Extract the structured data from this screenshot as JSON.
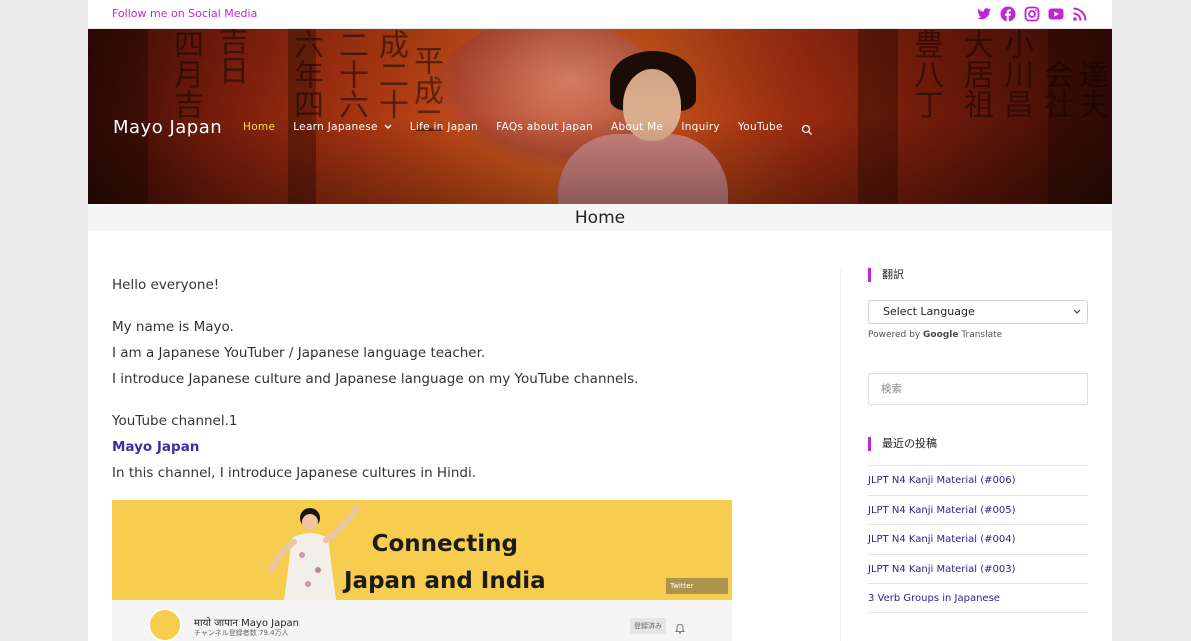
{
  "topbar": {
    "follow_text": "Follow me on Social Media",
    "icons": [
      "twitter-icon",
      "facebook-icon",
      "instagram-icon",
      "youtube-icon",
      "rss-icon"
    ],
    "icon_color": "#c026d3"
  },
  "header": {
    "brand": "Mayo Japan",
    "nav": [
      {
        "label": "Home",
        "active": true
      },
      {
        "label": "Learn Japanese",
        "has_dropdown": true
      },
      {
        "label": "Life in Japan"
      },
      {
        "label": "FAQs about Japan"
      },
      {
        "label": "About Me"
      },
      {
        "label": "Inquiry"
      },
      {
        "label": "YouTube"
      }
    ],
    "active_color": "#f5e04a"
  },
  "page_title": "Home",
  "content": {
    "greeting": "Hello everyone!",
    "intro_1": "My name is Mayo.",
    "intro_2": "I am a Japanese YouTuber / Japanese language teacher.",
    "intro_3": "I introduce Japanese culture and Japanese language on my YouTube channels.",
    "channel_label": "YouTube channel.1",
    "channel_link": "Mayo Japan",
    "channel_desc": "In this channel, I introduce Japanese cultures in Hindi.",
    "banner": {
      "headline_1": "Connecting",
      "headline_2": "Japan and India",
      "twitter_label": "Twitter",
      "channel_name": "मायो जापान Mayo Japan",
      "subscribers": "チャンネル登録者数 79.4万人",
      "subscribe_btn": "登録済み"
    }
  },
  "sidebar": {
    "translate_title": "翻訳",
    "language_select": "Select Language",
    "powered_by": "Powered by",
    "google": "Google",
    "translate": "Translate",
    "search_placeholder": "検索",
    "recent_title": "最近の投稿",
    "recent_posts": [
      "JLPT N4 Kanji Material (#006)",
      "JLPT N4 Kanji Material (#005)",
      "JLPT N4 Kanji Material (#004)",
      "JLPT N4 Kanji Material (#003)",
      "3 Verb Groups in Japanese"
    ]
  }
}
